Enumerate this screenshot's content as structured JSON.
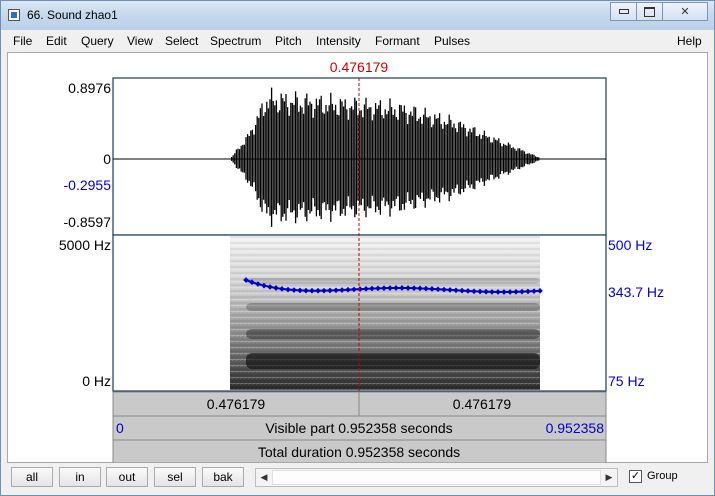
{
  "window": {
    "title": "66. Sound zhao1"
  },
  "menu": [
    "File",
    "Edit",
    "Query",
    "View",
    "Select",
    "Spectrum",
    "Pitch",
    "Intensity",
    "Formant",
    "Pulses"
  ],
  "menu_help": "Help",
  "cursor": {
    "time": "0.476179"
  },
  "waveform": {
    "max_label": "0.8976",
    "zero_label": "0",
    "cursor_value": "-0.2955",
    "min_label": "-0.8597"
  },
  "spectrogram": {
    "freq_top": "5000 Hz",
    "freq_bottom": "0 Hz",
    "pitch_top": "500 Hz",
    "pitch_cursor": "343.7 Hz",
    "pitch_bottom": "75 Hz"
  },
  "bars": {
    "left_seg": "0.476179",
    "right_seg": "0.476179",
    "visible_start": "0",
    "visible_text": "Visible part 0.952358 seconds",
    "visible_end": "0.952358",
    "total_text": "Total duration 0.952358 seconds"
  },
  "toolbar": {
    "all": "all",
    "in": "in",
    "out": "out",
    "sel": "sel",
    "bak": "bak",
    "group_label": "Group",
    "group_checked": true
  },
  "colors": {
    "cursor": "#cc0000",
    "pitch": "#0000cc",
    "blue_label": "#0000cc"
  }
}
